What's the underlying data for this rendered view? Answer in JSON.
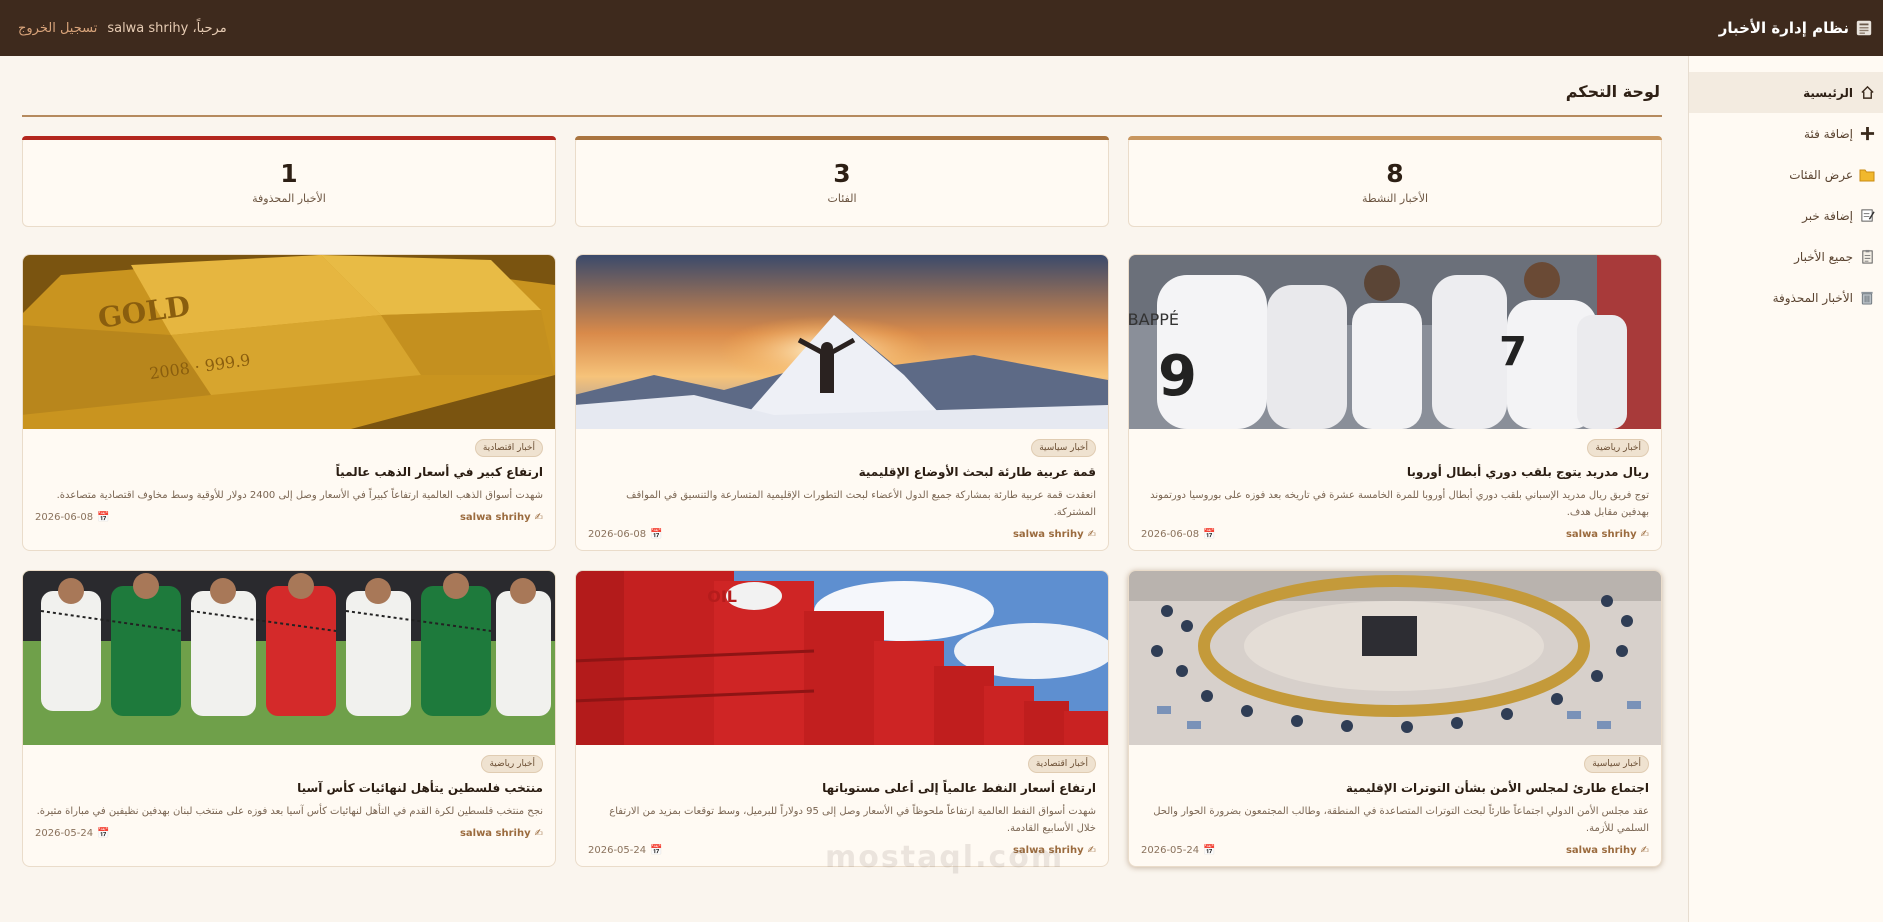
{
  "header": {
    "app_title": "نظام إدارة الأخبار",
    "greeting": "مرحباً، salwa shrihy",
    "logout_label": "تسجيل الخروج"
  },
  "sidebar": {
    "items": [
      {
        "label": "الرئيسية",
        "icon": "home-icon",
        "active": true
      },
      {
        "label": "إضافة فئة",
        "icon": "plus-icon"
      },
      {
        "label": "عرض الفئات",
        "icon": "folder-icon"
      },
      {
        "label": "إضافة خبر",
        "icon": "note-icon"
      },
      {
        "label": "جميع الأخبار",
        "icon": "clipboard-icon"
      },
      {
        "label": "الأخبار المحذوفة",
        "icon": "trash-icon"
      }
    ]
  },
  "main": {
    "title": "لوحة التحكم",
    "stats": [
      {
        "value": "8",
        "label": "الأخبار النشطة",
        "color": "#c8965f"
      },
      {
        "value": "3",
        "label": "الفئات",
        "color": "#a9743f"
      },
      {
        "value": "1",
        "label": "الأخبار المحذوفة",
        "color": "#b3261e"
      }
    ],
    "news": [
      {
        "image": "football-celebration",
        "category": "أخبار رياضية",
        "title": "ريال مدريد يتوج بلقب دوري أبطال أوروبا",
        "desc": "توج فريق ريال مدريد الإسباني بلقب دوري أبطال أوروبا للمرة الخامسة عشرة في تاريخه بعد فوزه على بوروسيا دورتموند بهدفين مقابل هدف.",
        "author": "salwa shrihy",
        "date": "2026-06-08"
      },
      {
        "image": "mountain-sunset",
        "category": "أخبار سياسية",
        "title": "قمة عربية طارئة لبحث الأوضاع الإقليمية",
        "desc": "انعقدت قمة عربية طارئة بمشاركة جميع الدول الأعضاء لبحث التطورات الإقليمية المتسارعة والتنسيق في المواقف المشتركة.",
        "author": "salwa shrihy",
        "date": "2026-06-08"
      },
      {
        "image": "gold-bars",
        "category": "أخبار اقتصادية",
        "title": "ارتفاع كبير في أسعار الذهب عالمياً",
        "desc": "شهدت أسواق الذهب العالمية ارتفاعاً كبيراً في الأسعار وصل إلى 2400 دولار للأوقية وسط مخاوف اقتصادية متصاعدة.",
        "author": "salwa shrihy",
        "date": "2026-06-08"
      },
      {
        "image": "security-council",
        "category": "أخبار سياسية",
        "title": "اجتماع طارئ لمجلس الأمن بشأن التوترات الإقليمية",
        "desc": "عقد مجلس الأمن الدولي اجتماعاً طارئاً لبحث التوترات المتصاعدة في المنطقة، وطالب المجتمعون بضرورة الحوار والحل السلمي للأزمة.",
        "author": "salwa shrihy",
        "date": "2026-05-24"
      },
      {
        "image": "oil-barrels",
        "category": "أخبار اقتصادية",
        "title": "ارتفاع أسعار النفط عالمياً إلى أعلى مستوياتها",
        "desc": "شهدت أسواق النفط العالمية ارتفاعاً ملحوظاً في الأسعار وصل إلى 95 دولاراً للبرميل، وسط توقعات بمزيد من الارتفاع خلال الأسابيع القادمة.",
        "author": "salwa shrihy",
        "date": "2026-05-24"
      },
      {
        "image": "palestine-team",
        "category": "أخبار رياضية",
        "title": "منتخب فلسطين يتأهل لنهائيات كأس آسيا",
        "desc": "نجح منتخب فلسطين لكرة القدم في التأهل لنهائيات كأس آسيا بعد فوزه على منتخب لبنان بهدفين نظيفين في مباراة مثيرة.",
        "author": "salwa shrihy",
        "date": "2026-05-24"
      }
    ]
  },
  "watermark": "mostaql.com"
}
